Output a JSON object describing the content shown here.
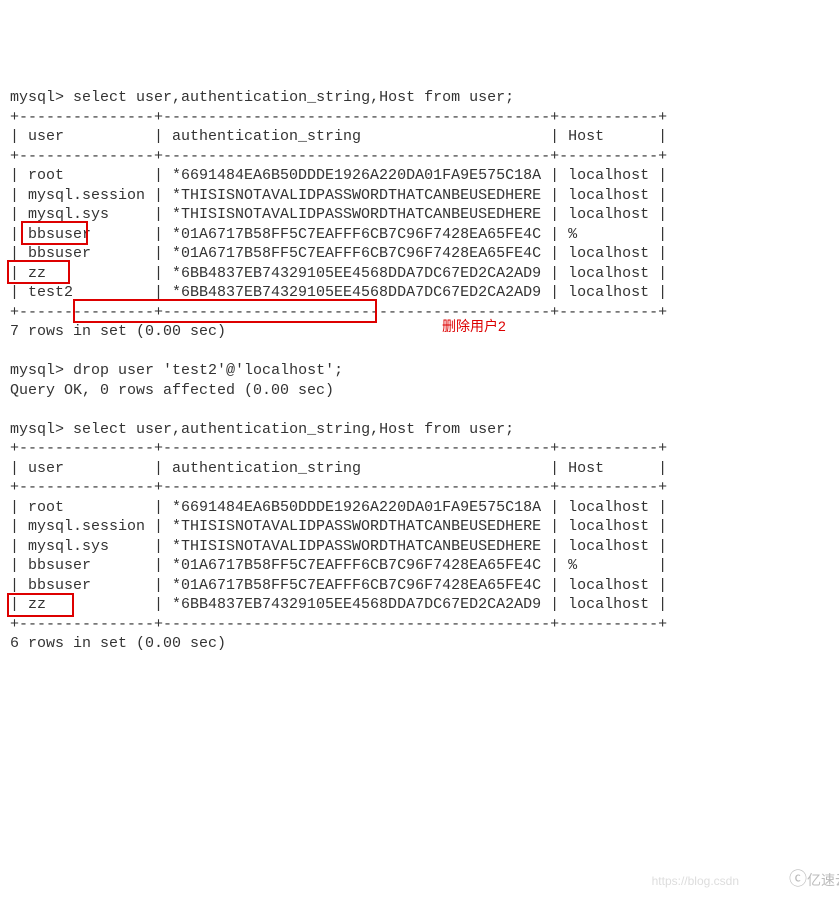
{
  "prompt": "mysql>",
  "query1": "select user,authentication_string,Host from user;",
  "table1": {
    "border_top": "+---------------+-------------------------------------------+-----------+",
    "header": "| user          | authentication_string                     | Host      |",
    "border_mid": "+---------------+-------------------------------------------+-----------+",
    "rows": [
      "| root          | *6691484EA6B50DDDE1926A220DA01FA9E575C18A | localhost |",
      "| mysql.session | *THISISNOTAVALIDPASSWORDTHATCANBEUSEDHERE | localhost |",
      "| mysql.sys     | *THISISNOTAVALIDPASSWORDTHATCANBEUSEDHERE | localhost |",
      "| bbsuser       | *01A6717B58FF5C7EAFFF6CB7C96F7428EA65FE4C | %         |",
      "| bbsuser       | *01A6717B58FF5C7EAFFF6CB7C96F7428EA65FE4C | localhost |",
      "| zz            | *6BB4837EB74329105EE4568DDA7DC67ED2CA2AD9 | localhost |",
      "| test2         | *6BB4837EB74329105EE4568DDA7DC67ED2CA2AD9 | localhost |"
    ],
    "border_bot": "+---------------+-------------------------------------------+-----------+"
  },
  "result1": "7 rows in set (0.00 sec)",
  "query2": "drop user 'test2'@'localhost';",
  "result2": "Query OK, 0 rows affected (0.00 sec)",
  "annotation": "删除用户2",
  "query3": "select user,authentication_string,Host from user;",
  "table2": {
    "border_top": "+---------------+-------------------------------------------+-----------+",
    "header": "| user          | authentication_string                     | Host      |",
    "border_mid": "+---------------+-------------------------------------------+-----------+",
    "rows": [
      "| root          | *6691484EA6B50DDDE1926A220DA01FA9E575C18A | localhost |",
      "| mysql.session | *THISISNOTAVALIDPASSWORDTHATCANBEUSEDHERE | localhost |",
      "| mysql.sys     | *THISISNOTAVALIDPASSWORDTHATCANBEUSEDHERE | localhost |",
      "| bbsuser       | *01A6717B58FF5C7EAFFF6CB7C96F7428EA65FE4C | %         |",
      "| bbsuser       | *01A6717B58FF5C7EAFFF6CB7C96F7428EA65FE4C | localhost |",
      "| zz            | *6BB4837EB74329105EE4568DDA7DC67ED2CA2AD9 | localhost |"
    ],
    "border_bot": "+---------------+-------------------------------------------+-----------+"
  },
  "result3": "6 rows in set (0.00 sec)",
  "watermark": "亿速云",
  "csdn": "https://blog.csdn"
}
